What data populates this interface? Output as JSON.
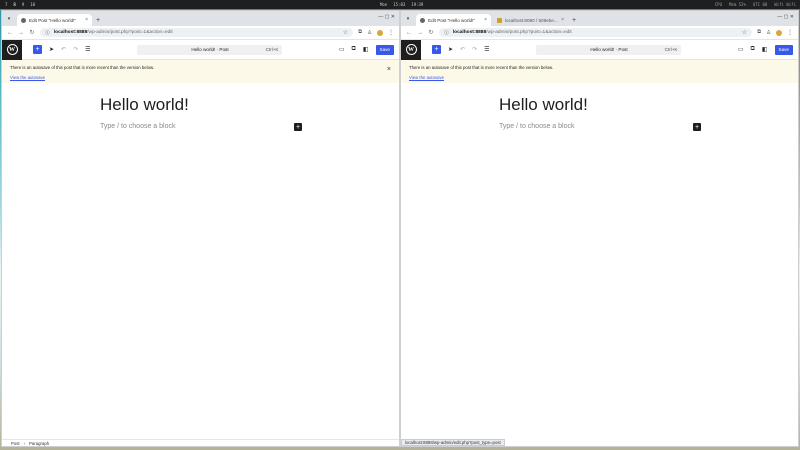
{
  "system_bar": {
    "workspaces": [
      "7",
      "8",
      "9",
      "10"
    ],
    "active_workspace": "8",
    "date": "Mon",
    "time1": "15:03",
    "time2": "19:39",
    "status_items": [
      "CPU",
      "Mem 52%",
      "UTC 00",
      "Wifi Wifi"
    ]
  },
  "left_window": {
    "tabs": [
      {
        "title": "Edit Post \"Hello world!\"",
        "favicon": "wordpress-icon",
        "active": true
      }
    ],
    "url_host": "localhost:8888",
    "url_path": "/wp-admin/post.php?post=1&action=edit",
    "document_bar": {
      "title": "Hello world! · Post",
      "shortcut": "Ctrl+K"
    },
    "save_label": "Save",
    "notice_text": "There is an autosave of this post that is more recent than the version below.",
    "notice_link": "View the autosave",
    "post_title": "Hello world!",
    "block_placeholder": "Type / to choose a block",
    "breadcrumb": [
      "Post",
      "Paragraph"
    ]
  },
  "right_window": {
    "tabs": [
      {
        "title": "Edit Post \"Hello world!\"",
        "favicon": "wordpress-icon",
        "active": true
      },
      {
        "title": "localhost:8080 / 509ebe...",
        "favicon": "db-icon",
        "active": false
      }
    ],
    "url_host": "localhost:8888",
    "url_path": "/wp-admin/post.php?post=1&action=edit",
    "document_bar": {
      "title": "Hello world! · Post",
      "shortcut": "Ctrl+K"
    },
    "save_label": "Save",
    "notice_text": "There is an autosave of this post that is more recent than the version below.",
    "notice_link": "View the autosave",
    "post_title": "Hello world!",
    "block_placeholder": "Type / to choose a block",
    "status_url": "localhost:8888/wp-admin/edit.php?post_type=post"
  },
  "colors": {
    "wp_accent": "#3858e9",
    "notice_bg": "#fcf9e8",
    "wp_dark": "#1e1e1e"
  }
}
